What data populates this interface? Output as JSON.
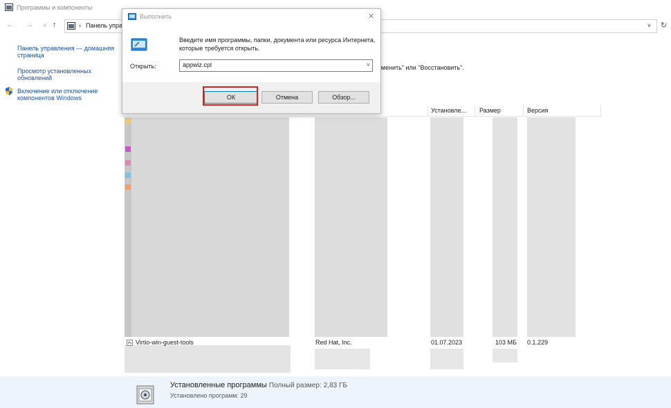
{
  "window": {
    "title": "Программы и компоненты"
  },
  "nav": {
    "back": "←",
    "forward": "→",
    "recent": "˅",
    "up": "↑",
    "address_separator": "›",
    "address_text": "Панель управления",
    "address_dropdown": "˅",
    "refresh": "↻"
  },
  "sidebar": {
    "items": [
      {
        "label": "Панель управления — домашняя страница"
      },
      {
        "label": "Просмотр установленных обновлений"
      },
      {
        "label": "Включение или отключение компонентов Windows"
      }
    ]
  },
  "main": {
    "instruction_tail": "\"Изменить\" или \"Восстановить\".",
    "columns": [
      "Установле...",
      "Размер",
      "Версия"
    ],
    "visible_row": {
      "name": "Virtio-win-guest-tools",
      "publisher": "Red Hat, Inc.",
      "installed": "01.07.2023",
      "size": "103 МБ",
      "version": "0.1.229"
    }
  },
  "footer": {
    "title": "Установленные программы",
    "total_size_label": "Полный размер:",
    "total_size": "2,83 ГБ",
    "count_label": "Установлено программ: 29"
  },
  "run_dialog": {
    "title": "Выполнить",
    "close": "✕",
    "description": "Введите имя программы, папки, документа или ресурса Интернета, которые требуется открыть.",
    "open_label": "Открыть:",
    "input_value": "appwiz.cpl",
    "dropdown": "˅",
    "buttons": {
      "ok": "ОК",
      "cancel": "Отмена",
      "browse": "Обзор..."
    }
  },
  "colors": {
    "accent": "#0078d7",
    "highlight": "#d32424",
    "link": "#1b4fa0",
    "footer_bg": "#eef4fb"
  }
}
